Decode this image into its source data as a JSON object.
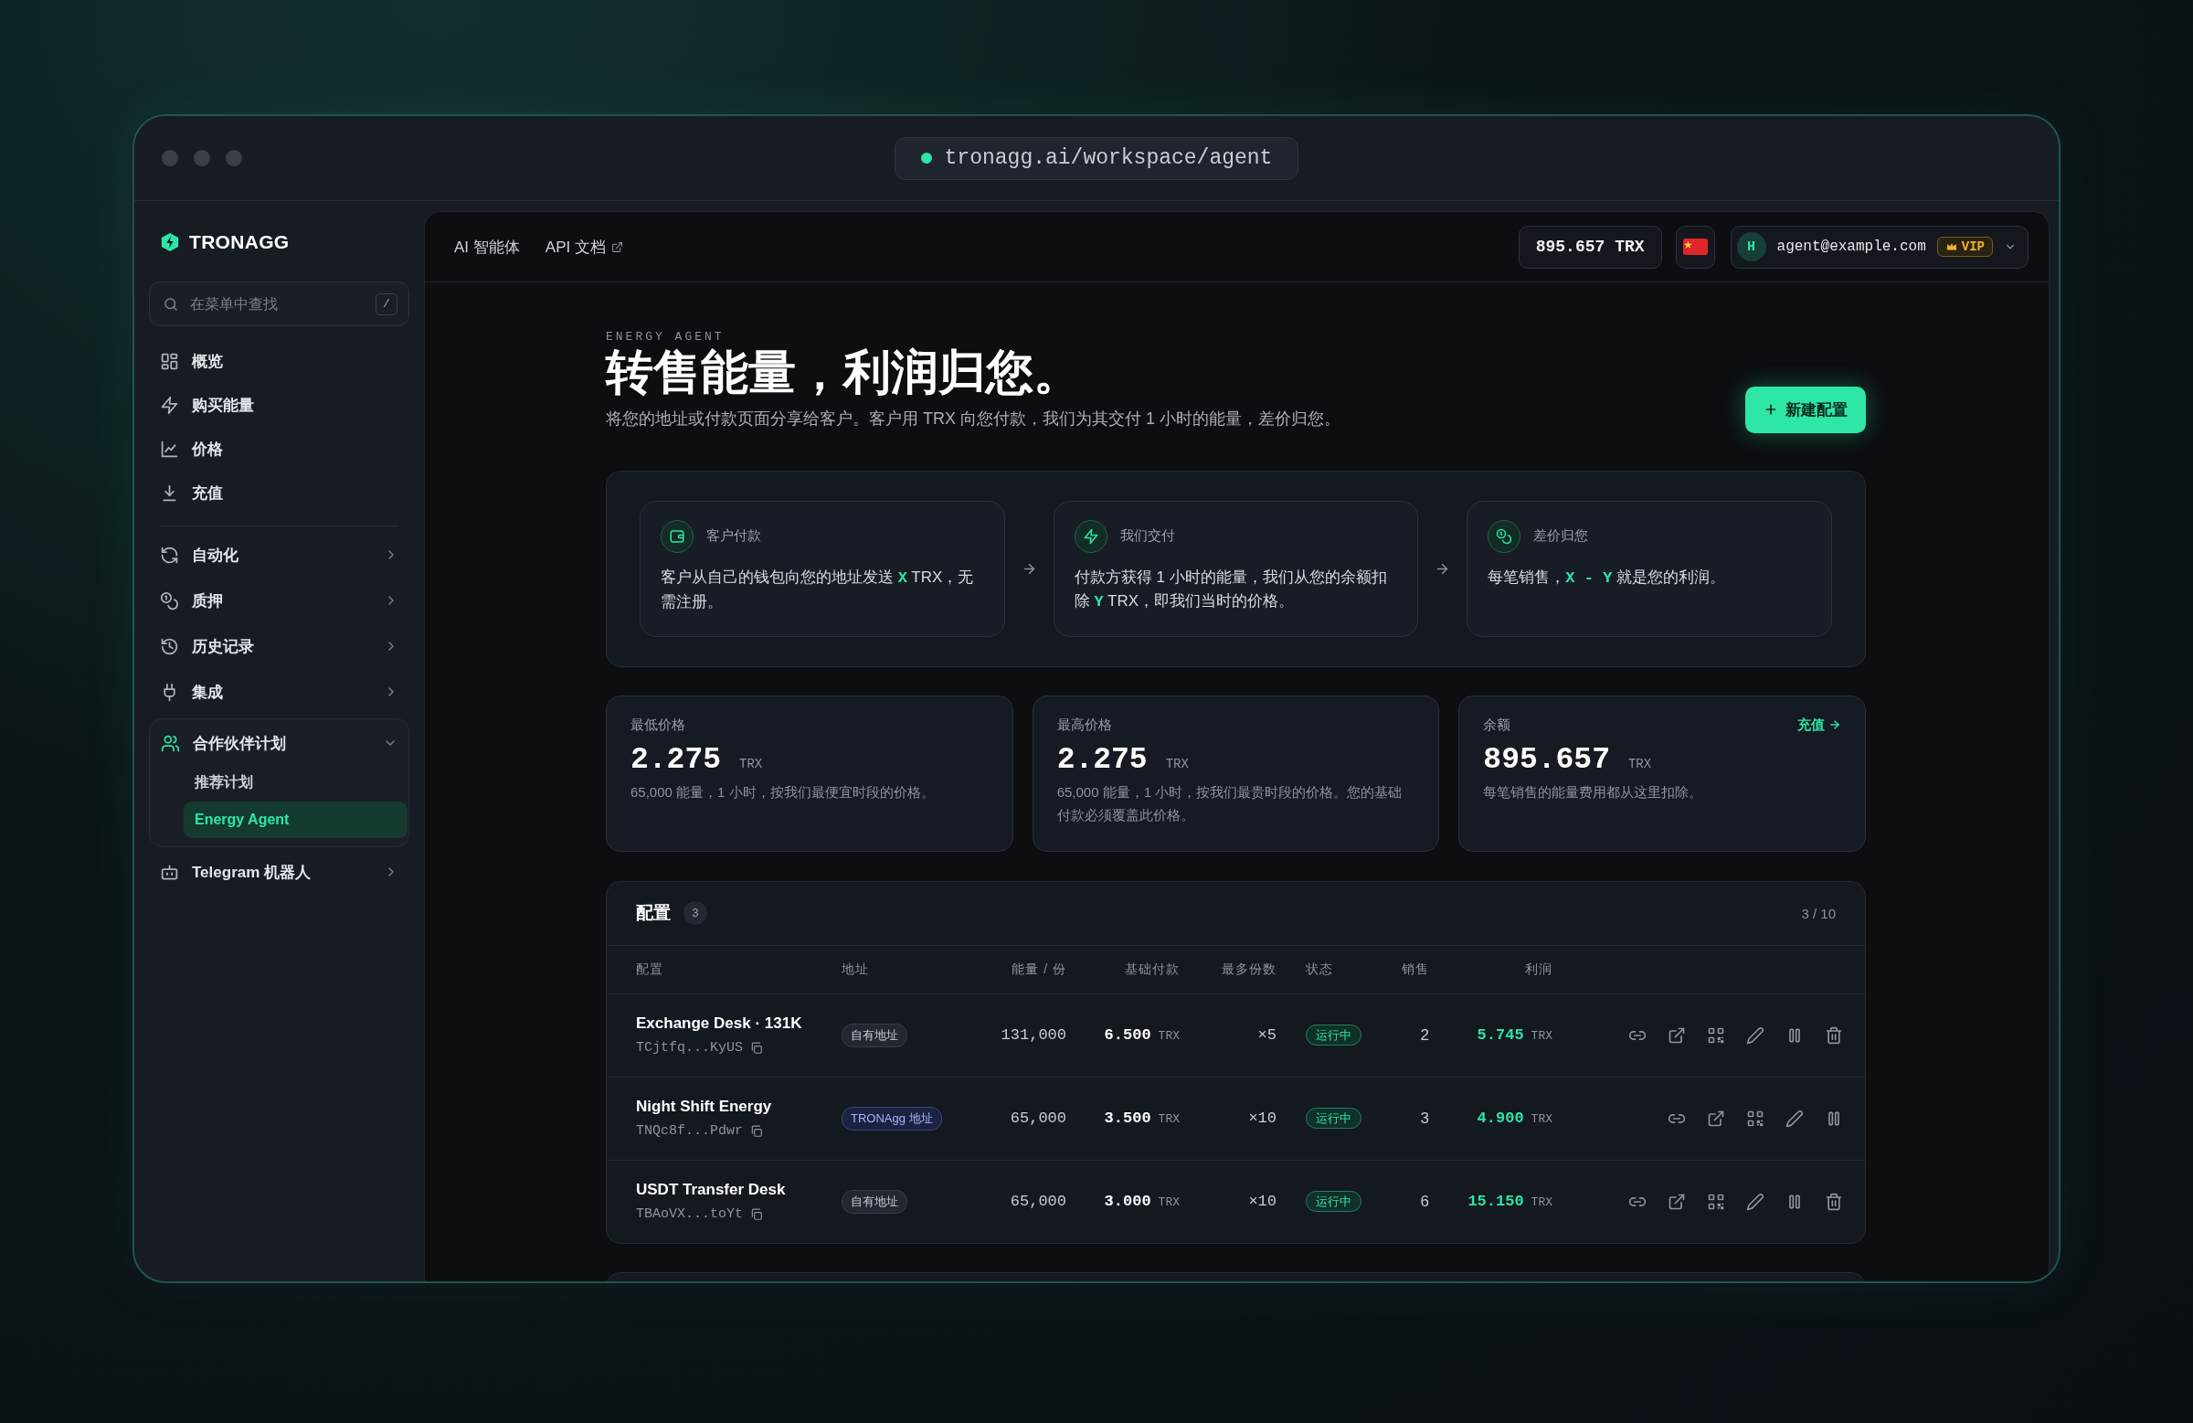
{
  "window": {
    "url": "tronagg.ai/workspace/agent"
  },
  "sidebar": {
    "brand": "TRONAGG",
    "search": {
      "placeholder": "在菜单中查找",
      "shortcut": "/"
    },
    "primary": [
      {
        "label": "概览"
      },
      {
        "label": "购买能量"
      },
      {
        "label": "价格"
      },
      {
        "label": "充值"
      }
    ],
    "secondary": [
      {
        "label": "自动化",
        "expanded": false
      },
      {
        "label": "质押",
        "expanded": false
      },
      {
        "label": "历史记录",
        "expanded": false
      },
      {
        "label": "集成",
        "expanded": false
      },
      {
        "label": "合作伙伴计划",
        "expanded": true,
        "children": [
          {
            "label": "推荐计划",
            "selected": false
          },
          {
            "label": "Energy Agent",
            "selected": true
          }
        ]
      },
      {
        "label": "Telegram 机器人",
        "expanded": false
      }
    ]
  },
  "topbar": {
    "links": [
      {
        "label": "AI 智能体",
        "external": false
      },
      {
        "label": "API 文档",
        "external": true
      }
    ],
    "balance": "895.657 TRX",
    "account": {
      "avatar": "H",
      "email": "agent@example.com",
      "badge": "VIP"
    }
  },
  "hero": {
    "eyebrow": "ENERGY AGENT",
    "title": "转售能量，利润归您。",
    "subtitle": "将您的地址或付款页面分享给客户。客户用 TRX 向您付款，我们为其交付 1 小时的能量，差价归您。",
    "button": "新建配置"
  },
  "steps": [
    {
      "title": "客户付款",
      "text": "客户从自己的钱包向您的地址发送 **X** TRX，无需注册。"
    },
    {
      "title": "我们交付",
      "text": "付款方获得 1 小时的能量，我们从您的余额扣除 **Y** TRX，即我们当时的价格。"
    },
    {
      "title": "差价归您",
      "text": "每笔销售，**X - Y** 就是您的利润。"
    }
  ],
  "stats": [
    {
      "label": "最低价格",
      "value": "2.275",
      "unit": "TRX",
      "note": "65,000 能量，1 小时，按我们最便宜时段的价格。"
    },
    {
      "label": "最高价格",
      "value": "2.275",
      "unit": "TRX",
      "note": "65,000 能量，1 小时，按我们最贵时段的价格。您的基础付款必须覆盖此价格。"
    },
    {
      "label": "余额",
      "value": "895.657",
      "unit": "TRX",
      "note": "每笔销售的能量费用都从这里扣除。",
      "link": "充值"
    }
  ],
  "table": {
    "title": "配置",
    "count": "3",
    "quota": "3 / 10",
    "columns": [
      "配置",
      "地址",
      "能量 / 份",
      "基础付款",
      "最多份数",
      "状态",
      "销售",
      "利润"
    ],
    "rows": [
      {
        "name": "Exchange Desk · 131K",
        "address": "TCjtfq...KyUS",
        "address_tag": {
          "label": "自有地址",
          "kind": "own"
        },
        "energy": "131,000",
        "base": "6.500",
        "base_unit": "TRX",
        "max": "×5",
        "status": "运行中",
        "sales": "2",
        "profit": "5.745",
        "profit_unit": "TRX",
        "deletable": true
      },
      {
        "name": "Night Shift Energy",
        "address": "TNQc8f...Pdwr",
        "address_tag": {
          "label": "TRONAgg 地址",
          "kind": "platform"
        },
        "energy": "65,000",
        "base": "3.500",
        "base_unit": "TRX",
        "max": "×10",
        "status": "运行中",
        "sales": "3",
        "profit": "4.900",
        "profit_unit": "TRX",
        "deletable": false
      },
      {
        "name": "USDT Transfer Desk",
        "address": "TBAoVX...toYt",
        "address_tag": {
          "label": "自有地址",
          "kind": "own"
        },
        "energy": "65,000",
        "base": "3.000",
        "base_unit": "TRX",
        "max": "×10",
        "status": "运行中",
        "sales": "6",
        "profit": "15.150",
        "profit_unit": "TRX",
        "deletable": true
      }
    ]
  }
}
